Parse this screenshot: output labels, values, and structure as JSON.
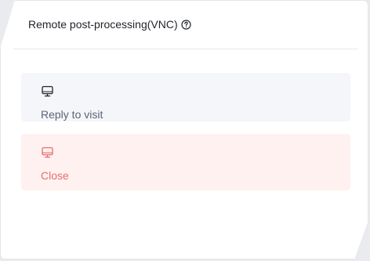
{
  "header": {
    "title": "Remote post-processing(VNC)",
    "help_icon": "question-circle-icon"
  },
  "actions": [
    {
      "label": "Reply to visit",
      "icon": "monitor-icon",
      "color": "#5b6473",
      "background": "#f5f6fa"
    },
    {
      "label": "Close",
      "icon": "monitor-icon",
      "color": "#e66d6d",
      "background": "#fff1f0"
    }
  ]
}
